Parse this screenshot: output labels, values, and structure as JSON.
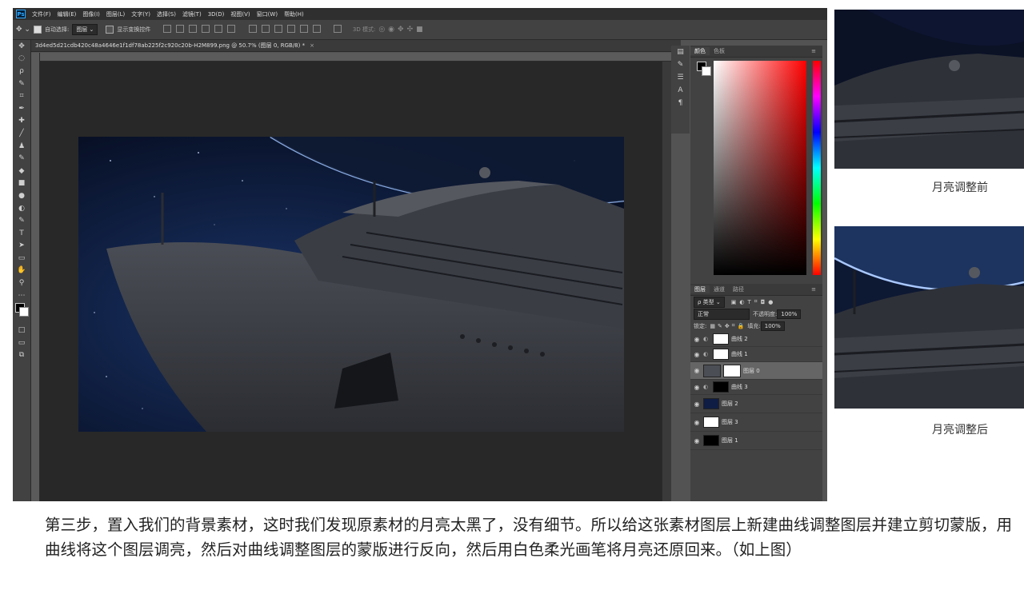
{
  "menubar": {
    "logo": "Ps",
    "items": [
      "文件(F)",
      "编辑(E)",
      "图像(I)",
      "图层(L)",
      "文字(Y)",
      "选择(S)",
      "滤镜(T)",
      "3D(D)",
      "视图(V)",
      "窗口(W)",
      "帮助(H)"
    ]
  },
  "options": {
    "autoselect_label": "自动选择:",
    "autoselect_value": "图层",
    "show_transform_label": "显示变换控件",
    "mode_3d_label": "3D 模式:"
  },
  "document": {
    "tab_title": "3d4ed5d21cdb420c48a4646e1f1df78ab225f2c920c20b-H2M899.png @ 50.7% (图层 0, RGB/8) *",
    "close": "×"
  },
  "tools": [
    "✥",
    "◌",
    "ρ",
    "✎",
    "⌗",
    "✒",
    "✚",
    "╱",
    "♟",
    "✎",
    "◆",
    "■",
    "●",
    "◐",
    "✎",
    "T",
    "➤",
    "▭",
    "✋",
    "⚲",
    "⋯",
    "◧",
    "□",
    "▭",
    "⧉"
  ],
  "panels": {
    "color_tab": "颜色",
    "swatches_tab": "色板",
    "layers_tab": "图层",
    "channels_tab": "通道",
    "paths_tab": "路径",
    "filter_kind": "ρ 类型",
    "blend_mode": "正常",
    "opacity_label": "不透明度:",
    "opacity_value": "100%",
    "lock_label": "锁定:",
    "fill_label": "填充:",
    "fill_value": "100%",
    "layers": [
      {
        "name": "曲线 2"
      },
      {
        "name": "曲线 1"
      },
      {
        "name": "图层 0"
      },
      {
        "name": "曲线 3"
      },
      {
        "name": "图层 2"
      },
      {
        "name": "图层 3"
      },
      {
        "name": "图层 1"
      }
    ]
  },
  "captions": {
    "before": "月亮调整前",
    "after": "月亮调整后"
  },
  "paragraph": "第三步，置入我们的背景素材，这时我们发现原素材的月亮太黑了，没有细节。所以给这张素材图层上新建曲线调整图层并建立剪切蒙版，用曲线将这个图层调亮，然后对曲线调整图层的蒙版进行反向，然后用白色柔光画笔将月亮还原回来。（如上图）",
  "colors": {
    "ps_bg": "#535353",
    "panel": "#424242",
    "menubar": "#2f2f2f",
    "canvas_bg": "#282828",
    "sky": "#0c1a3a",
    "ship": "#3d4046"
  }
}
